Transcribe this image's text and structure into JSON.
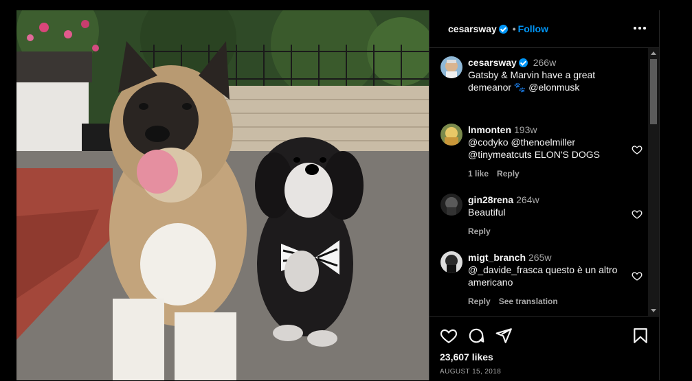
{
  "post": {
    "author": "cesarsway",
    "follow_label": "Follow",
    "separator": "•",
    "caption_time": "266w",
    "caption_text": "Gatsby & Marvin have a great demeanor 🐾 @elonmusk",
    "likes": "23,607 likes",
    "date": "AUGUST 15, 2018"
  },
  "comments": [
    {
      "user": "lnmonten",
      "time": "193w",
      "text": "@codyko @thenoelmiller @tinymeatcuts ELON'S DOGS",
      "likes_label": "1 like",
      "reply_label": "Reply"
    },
    {
      "user": "gin28rena",
      "time": "264w",
      "text": "Beautiful",
      "reply_label": "Reply"
    },
    {
      "user": "migt_branch",
      "time": "265w",
      "text": "@_davide_frasca questo è un altro americano",
      "reply_label": "Reply",
      "translate_label": "See translation"
    }
  ],
  "icons": [
    "verified-badge-icon",
    "more-options-icon",
    "heart-icon",
    "comment-icon",
    "share-icon",
    "bookmark-icon"
  ],
  "colors": {
    "accent": "#0095f6",
    "background": "#000000",
    "muted": "#a8a8a8"
  }
}
